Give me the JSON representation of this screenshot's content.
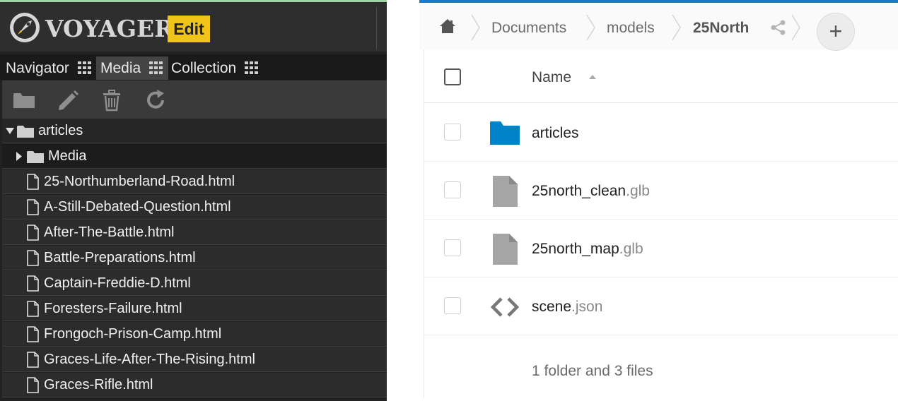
{
  "voyager": {
    "app_name": "VOYAGER",
    "mode_badge": "Edit",
    "tabs": [
      {
        "label": "Navigator",
        "icon": "grid-icon"
      },
      {
        "label": "Media",
        "icon": "grid-icon",
        "active": true
      },
      {
        "label": "Collection",
        "icon": "grid-icon"
      }
    ],
    "toolbar": [
      "folder-icon",
      "pencil-icon",
      "trash-icon",
      "refresh-icon"
    ],
    "tree": {
      "root_folder": "articles",
      "sub_folder": "Media",
      "files": [
        "25-Northumberland-Road.html",
        "A-Still-Debated-Question.html",
        "After-The-Battle.html",
        "Battle-Preparations.html",
        "Captain-Freddie-D.html",
        "Foresters-Failure.html",
        "Frongoch-Prison-Camp.html",
        "Graces-Life-After-The-Rising.html",
        "Graces-Rifle.html"
      ]
    }
  },
  "files_app": {
    "breadcrumb": [
      "Documents",
      "models",
      "25North"
    ],
    "add_button": "+",
    "column_name": "Name",
    "rows": [
      {
        "base": "articles",
        "ext": "",
        "type": "folder"
      },
      {
        "base": "25north_clean",
        "ext": ".glb",
        "type": "file"
      },
      {
        "base": "25north_map",
        "ext": ".glb",
        "type": "file"
      },
      {
        "base": "scene",
        "ext": ".json",
        "type": "code"
      }
    ],
    "summary": "1 folder and 3 files",
    "colors": {
      "accent": "#1e78c8",
      "folder": "#0082c9",
      "file": "#a5a5a5"
    }
  }
}
